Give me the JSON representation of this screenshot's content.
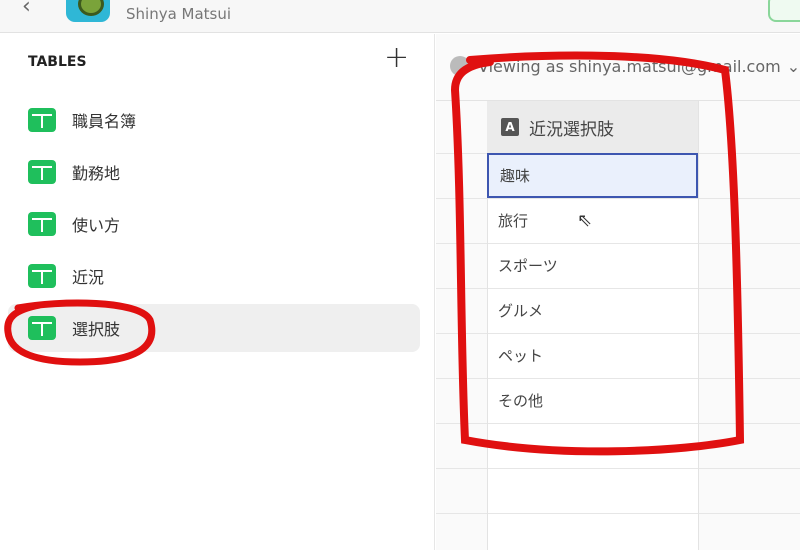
{
  "header": {
    "owner": "Shinya Matsui"
  },
  "sidebar": {
    "heading": "TABLES",
    "items": [
      {
        "label": "職員名簿"
      },
      {
        "label": "勤務地"
      },
      {
        "label": "使い方"
      },
      {
        "label": "近況"
      },
      {
        "label": "選択肢",
        "selected": true
      }
    ]
  },
  "main": {
    "viewing": "Viewing as shinya.matsui@gmail.com",
    "column": {
      "type_badge": "A",
      "name": "近況選択肢"
    },
    "rows": [
      "趣味",
      "旅行",
      "スポーツ",
      "グルメ",
      "ペット",
      "その他"
    ]
  },
  "colors": {
    "accent": "#1fbf5c",
    "annotation": "#e01010",
    "selection": "#3d56b0"
  }
}
